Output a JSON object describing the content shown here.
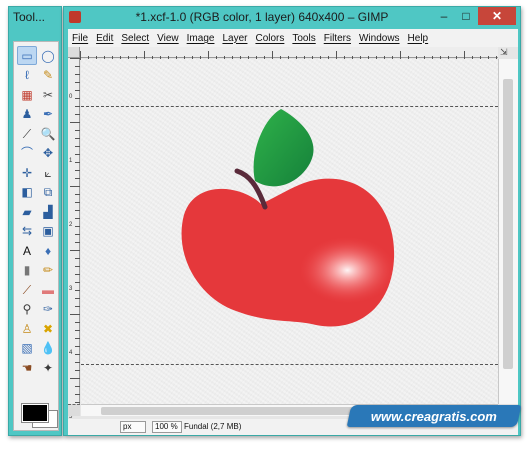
{
  "toolbox": {
    "title": "Tool...",
    "tools": [
      {
        "name": "rect-select-icon",
        "glyph": "▭",
        "color": "#3b6fb6",
        "active": true
      },
      {
        "name": "ellipse-select-icon",
        "glyph": "◯",
        "color": "#3b6fb6"
      },
      {
        "name": "free-select-icon",
        "glyph": "ℓ",
        "color": "#3b6fb6"
      },
      {
        "name": "fuzzy-select-icon",
        "glyph": "✎",
        "color": "#c48a18"
      },
      {
        "name": "select-by-color-icon",
        "glyph": "▦",
        "color": "#c0392b"
      },
      {
        "name": "scissors-icon",
        "glyph": "✂",
        "color": "#4a4a4a"
      },
      {
        "name": "foreground-select-icon",
        "glyph": "♟",
        "color": "#2c5e9e"
      },
      {
        "name": "paths-icon",
        "glyph": "✒",
        "color": "#3b6fb6"
      },
      {
        "name": "color-picker-icon",
        "glyph": "⟋",
        "color": "#3a3a3a"
      },
      {
        "name": "zoom-icon",
        "glyph": "🔍",
        "color": "#3b6fb6"
      },
      {
        "name": "measure-icon",
        "glyph": "⌒",
        "color": "#3b6fb6"
      },
      {
        "name": "move-icon",
        "glyph": "✥",
        "color": "#2c5e9e"
      },
      {
        "name": "align-icon",
        "glyph": "✛",
        "color": "#2c5e9e"
      },
      {
        "name": "crop-icon",
        "glyph": "⟀",
        "color": "#4a4a4a"
      },
      {
        "name": "rotate-icon",
        "glyph": "◧",
        "color": "#2c5e9e"
      },
      {
        "name": "scale-icon",
        "glyph": "⧉",
        "color": "#2c5e9e"
      },
      {
        "name": "shear-icon",
        "glyph": "▰",
        "color": "#2c5e9e"
      },
      {
        "name": "perspective-icon",
        "glyph": "▟",
        "color": "#2c5e9e"
      },
      {
        "name": "flip-icon",
        "glyph": "⇆",
        "color": "#2c5e9e"
      },
      {
        "name": "cage-transform-icon",
        "glyph": "▣",
        "color": "#2c5e9e"
      },
      {
        "name": "text-icon",
        "glyph": "A",
        "color": "#111111"
      },
      {
        "name": "bucket-fill-icon",
        "glyph": "♦",
        "color": "#3b6fb6"
      },
      {
        "name": "blend-icon",
        "glyph": "▮",
        "color": "#777777"
      },
      {
        "name": "pencil-icon",
        "glyph": "✏",
        "color": "#c48a18"
      },
      {
        "name": "paintbrush-icon",
        "glyph": "⟋",
        "color": "#8a4b22"
      },
      {
        "name": "eraser-icon",
        "glyph": "▬",
        "color": "#e07a7a"
      },
      {
        "name": "airbrush-icon",
        "glyph": "⚲",
        "color": "#3a3a3a"
      },
      {
        "name": "ink-icon",
        "glyph": "✑",
        "color": "#2c5e9e"
      },
      {
        "name": "clone-icon",
        "glyph": "♙",
        "color": "#c48a18"
      },
      {
        "name": "heal-icon",
        "glyph": "✖",
        "color": "#d9a400"
      },
      {
        "name": "perspective-clone-icon",
        "glyph": "▧",
        "color": "#3b6fb6"
      },
      {
        "name": "blur-icon",
        "glyph": "💧",
        "color": "#3b6fb6"
      },
      {
        "name": "smudge-icon",
        "glyph": "☚",
        "color": "#8a4b22"
      },
      {
        "name": "dodge-burn-icon",
        "glyph": "✦",
        "color": "#3a3a3a"
      }
    ]
  },
  "image_window": {
    "title": "*1.xcf-1.0 (RGB color, 1 layer) 640x400 – GIMP",
    "window_buttons": {
      "minimize": "–",
      "maximize": "□",
      "close": "✕"
    },
    "menus": [
      "File",
      "Edit",
      "Select",
      "View",
      "Image",
      "Layer",
      "Colors",
      "Tools",
      "Filters",
      "Windows",
      "Help"
    ],
    "rulers": {
      "top_labels": [
        "",
        "",
        "",
        "",
        "",
        ""
      ],
      "left_labels": [
        "0",
        "1",
        "2",
        "3",
        "4",
        "5"
      ]
    },
    "status": {
      "unit": "px",
      "zoom": "100 %",
      "layer_info": "Fundal (2,7 MB)"
    }
  },
  "watermark": "www.creagratis.com",
  "colors": {
    "window_frame": "#4fc7c4",
    "close_button": "#c7463a",
    "apple_red": "#e5383b",
    "leaf_green": "#1f9a3a",
    "stem": "#5a2a3a",
    "watermark_bg": "#2a78b8"
  }
}
